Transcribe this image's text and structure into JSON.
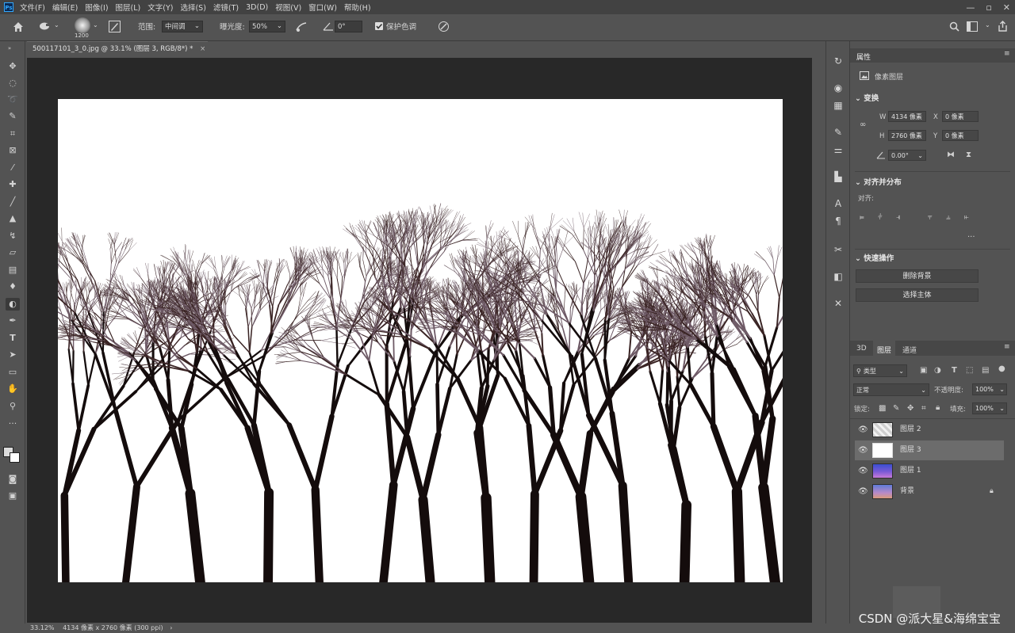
{
  "menu": {
    "items": [
      "文件(F)",
      "编辑(E)",
      "图像(I)",
      "图层(L)",
      "文字(Y)",
      "选择(S)",
      "滤镜(T)",
      "3D(D)",
      "视图(V)",
      "窗口(W)",
      "帮助(H)"
    ],
    "window_controls": [
      "—",
      "▫",
      "✕"
    ]
  },
  "options_bar": {
    "brush_size": "1200",
    "range_label": "范围:",
    "range_value": "中间调",
    "exposure_label": "曝光度:",
    "exposure_value": "50%",
    "angle_value": "0°",
    "protect_tones_label": "保护色调",
    "protect_tones_checked": true
  },
  "document": {
    "tab_title": "500117101_3_0.jpg @ 33.1% (图层 3, RGB/8*) *",
    "status_zoom": "33.12%",
    "status_info": "4134 像素 x 2760 像素 (300 ppi)"
  },
  "properties": {
    "tab_label": "属性",
    "layer_type": "像素图层",
    "transform_label": "变换",
    "w_label": "W",
    "w_value": "4134 像素",
    "h_label": "H",
    "h_value": "2760 像素",
    "x_label": "X",
    "x_value": "0 像素",
    "y_label": "Y",
    "y_value": "0 像素",
    "angle_value": "0.00°",
    "align_label": "对齐并分布",
    "align_sub": "对齐:",
    "more": "···",
    "quick_actions_label": "快速操作",
    "remove_bg_button": "删除背景",
    "select_subject_button": "选择主体"
  },
  "layers_panel": {
    "tabs": [
      "3D",
      "图层",
      "通道"
    ],
    "active_tab": "图层",
    "filter_kind": "类型",
    "blend_mode": "正常",
    "opacity_label": "不透明度:",
    "opacity_value": "100%",
    "lock_label": "锁定:",
    "fill_label": "填充:",
    "fill_value": "100%",
    "layers": [
      {
        "name": "图层 2",
        "selected": false
      },
      {
        "name": "图层 3",
        "selected": true
      },
      {
        "name": "图层 1",
        "selected": false
      },
      {
        "name": "背景",
        "selected": false,
        "locked": true
      }
    ]
  },
  "watermark": "CSDN @派大星&海绵宝宝"
}
